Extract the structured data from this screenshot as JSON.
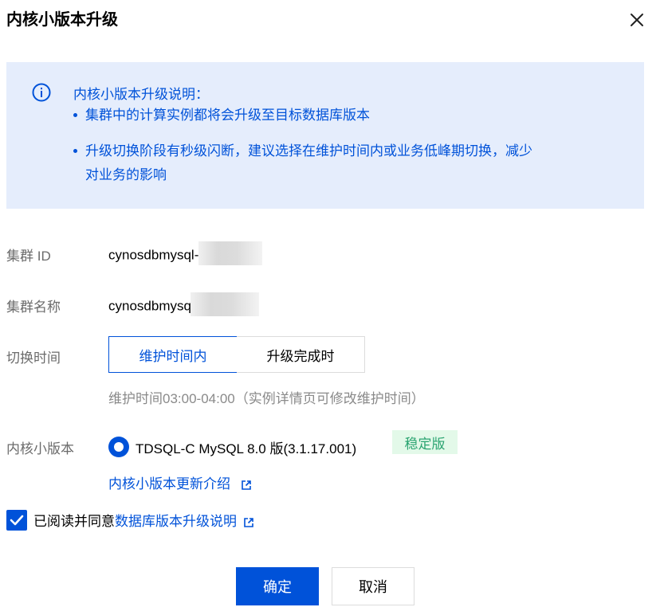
{
  "dialog": {
    "title": "内核小版本升级"
  },
  "notice": {
    "title": "内核小版本升级说明：",
    "items": [
      "集群中的计算实例都将会升级至目标数据库版本",
      "升级切换阶段有秒级闪断，建议选择在维护时间内或业务低峰期切换，减少",
      "对业务的影响"
    ]
  },
  "form": {
    "cluster_id": {
      "label": "集群 ID",
      "value": "cynosdbmysql-"
    },
    "cluster_name": {
      "label": "集群名称",
      "value": "cynosdbmysql-"
    },
    "switch_time": {
      "label": "切换时间",
      "options": [
        "维护时间内",
        "升级完成时"
      ],
      "selected": "维护时间内",
      "hint": "维护时间03:00-04:00（实例详情页可修改维护时间）"
    },
    "kernel_version": {
      "label": "内核小版本",
      "option": "TDSQL-C MySQL 8.0 版(3.1.17.001)",
      "tag": "稳定版",
      "link": "内核小版本更新介绍"
    }
  },
  "agreement": {
    "text": "已阅读并同意",
    "link": "数据库版本升级说明",
    "checked": true
  },
  "footer": {
    "confirm": "确定",
    "cancel": "取消"
  },
  "colors": {
    "primary": "#0052d9",
    "notice_bg": "#e5edfc",
    "tag_bg": "#e3f9e9",
    "tag_text": "#2ba471"
  },
  "icons": [
    "close-icon",
    "info-icon",
    "external-link-icon",
    "check-icon"
  ]
}
